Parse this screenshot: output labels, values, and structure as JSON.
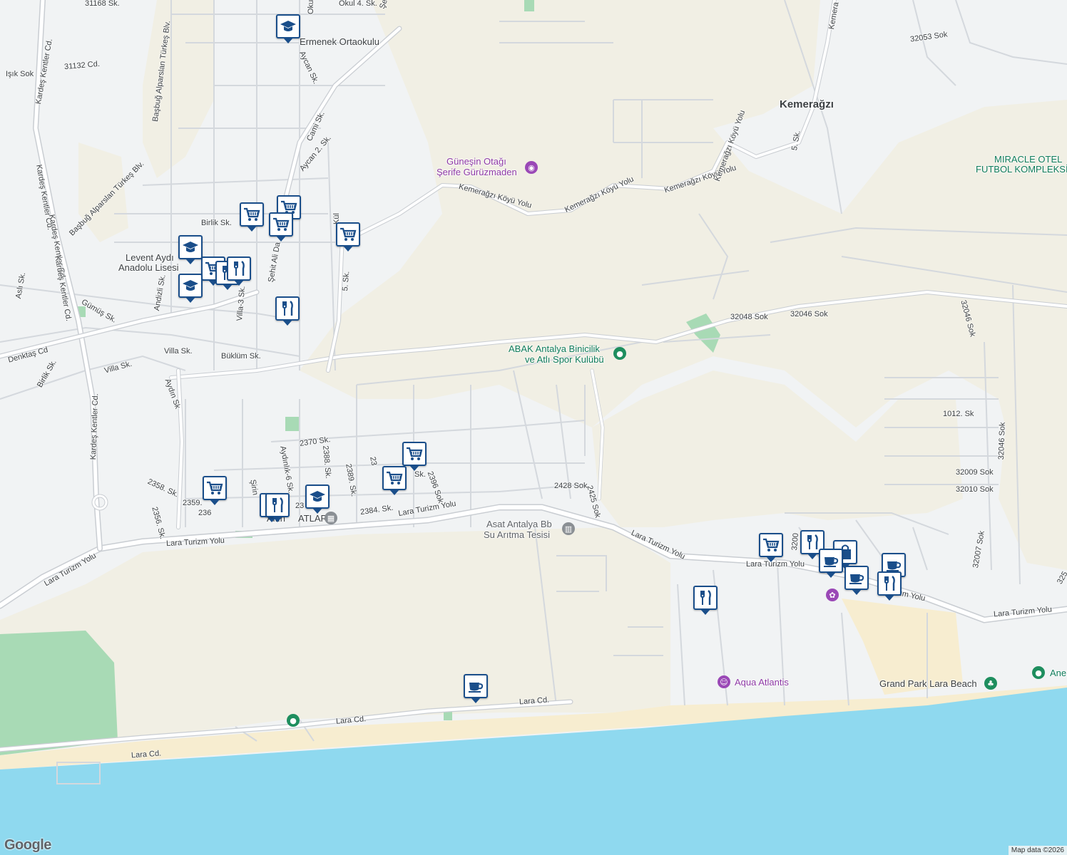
{
  "map": {
    "attribution": "Map data ©2026",
    "logo": "Google",
    "colors": {
      "land": "#f1f3f4",
      "beige": "#f1efe4",
      "sea": "#8fd9ef",
      "beach": "#f7edd0",
      "green": "#a8dab5",
      "road": "#ffffff",
      "road_edge": "#cfd4da"
    },
    "area_labels": {
      "kemeragzi": "Kemerağzı"
    },
    "poi_labels": {
      "gunesin_1": "Güneşin Otağı",
      "gunesin_2": "Şerife Gürüzmaden",
      "abak_1": "ABAK Antalya Binicilik",
      "abak_2": "ve Atlı Spor Kulübü",
      "asat_1": "Asat Antalya Bb",
      "asat_2": "Su Arıtma Tesisi",
      "aqua": "Aqua Atlantis",
      "grand_park": "Grand Park Lara Beach",
      "miracle_1": "MIRACLE OTEL",
      "miracle_2": "FUTBOL KOMPLEKSİ",
      "ane": "Ane",
      "ermenek": "Ermenek Ortaokulu",
      "levent_1": "Levent Aydı",
      "levent_2": "Anadolu Lisesi",
      "altin": "Altın",
      "atlar": "ATLAR"
    },
    "street_labels": {
      "s31168": "31168 Sk.",
      "okul4": "Okul 4. Sk.",
      "sehitali1": "Şehit Ali Da",
      "okul_v": "Okul",
      "s31132": "31132 Cd.",
      "isik": "Işık Sok",
      "kardes1": "Kardeş Kentler Cd.",
      "kardes2": "Kardeş Kentler Cd.",
      "kardes3": "Kardeş Kentler Cd.",
      "kardes4": "Kardeş Kentler Cd.",
      "kardes5": "Kardeş Kentler Cd.",
      "basbug1": "Başbuğ Alparslan Türkeş Blv.",
      "basbug2": "Başbuğ Alparslan Türkeş Blv.",
      "aycan": "Aycan Sk.",
      "cami": "Cami Sk.",
      "aycan2": "Aycan 2. Sk.",
      "birlik": "Birlik Sk.",
      "sehitali2": "Şehit Ali Da",
      "kul": "Kül",
      "sk5a": "5. Sk.",
      "asli": "Aslı Sk.",
      "andizli": "Andizli Sk.",
      "gumus": "Gümüş Sk.",
      "villa3": "Villa-3 Sk.",
      "denktas": "Denktaş Cd",
      "villa_sk": "Villa Sk.",
      "villa_sk2": "Villa Sk.",
      "buklum": "Büklüm Sk.",
      "birlik2": "Birlik Sk.",
      "aydin": "Aydın Sk",
      "s2370": "2370 Sk.",
      "s2388": "2388. Sk.",
      "s2389": "2389. Sk.",
      "aydinlik": "Aydınlık-6 Sk.",
      "s2396": "2396 Sok",
      "s23x": "23",
      "s2358": "2358. Sk.",
      "s2356": "2356. Sk.",
      "s2359": "2359.",
      "s236": "236",
      "sirin": "Şirin",
      "s2384": "2384. Sk.",
      "s23y": "23",
      "sk": "Sk.",
      "s2428": "2428 Sok",
      "s2425": "2425 Sok",
      "lara_tz1": "Lara Turizm Yolu",
      "lara_tz2": "Lara Turizm Yolu",
      "lara_tz3": "Lara Turizm Yolu",
      "lara_tz4": "Lara Turizm Yolu",
      "lara_tz5": "Lara Turizm Yolu",
      "lara_tz6": "Lara Turizm Yolu",
      "lara_tz7": "ızm Yolu",
      "lara_cd1": "Lara Cd.",
      "lara_cd2": "Lara Cd.",
      "lara_cd3": "Lara Cd.",
      "kemer_koy1": "Kemerağzı Köyü Yolu",
      "kemer_koy2": "Kemerağzı Köyü Yolu",
      "kemer_koy3": "Kemerağzı Köyü Yolu",
      "kemer_koy4": "Kemerağzı Köyü Yolu",
      "kemer_v": "Kemera",
      "sk5b": "5. Sk.",
      "s32053": "32053 Sok",
      "s32048": "32048 Sok",
      "s32046": "32046 Sok",
      "s32046v": "32046 Sok",
      "s32046v2": "32046 Sok",
      "s1012": "1012. Sk",
      "s32009": "32009 Sok",
      "s32010": "32010 Sok",
      "s32007": "32007 Sok",
      "s325": "325",
      "s3200": "3200"
    },
    "markers": [
      {
        "type": "school",
        "icon": "school-icon"
      },
      {
        "type": "shopping",
        "icon": "shopping-cart-icon"
      },
      {
        "type": "shopping",
        "icon": "shopping-cart-icon"
      },
      {
        "type": "shopping",
        "icon": "shopping-cart-icon"
      },
      {
        "type": "shopping",
        "icon": "shopping-cart-icon"
      },
      {
        "type": "school",
        "icon": "school-icon"
      },
      {
        "type": "shopping",
        "icon": "shopping-cart-icon"
      },
      {
        "type": "restaurant",
        "icon": "restaurant-icon"
      },
      {
        "type": "restaurant",
        "icon": "restaurant-icon"
      },
      {
        "type": "school",
        "icon": "school-icon"
      },
      {
        "type": "restaurant",
        "icon": "restaurant-icon"
      },
      {
        "type": "shopping",
        "icon": "shopping-cart-icon"
      },
      {
        "type": "shopping",
        "icon": "shopping-cart-icon"
      },
      {
        "type": "shopping",
        "icon": "shopping-cart-icon"
      },
      {
        "type": "restaurant",
        "icon": "restaurant-icon"
      },
      {
        "type": "school",
        "icon": "school-icon"
      },
      {
        "type": "restaurant",
        "icon": "restaurant-icon"
      },
      {
        "type": "cafe",
        "icon": "coffee-cup-icon"
      },
      {
        "type": "shopping",
        "icon": "shopping-cart-icon"
      },
      {
        "type": "restaurant",
        "icon": "restaurant-icon"
      },
      {
        "type": "restaurant",
        "icon": "restaurant-icon"
      },
      {
        "type": "shopping",
        "icon": "shopping-bag-icon"
      },
      {
        "type": "cafe",
        "icon": "coffee-cup-icon"
      },
      {
        "type": "cafe",
        "icon": "coffee-cup-icon"
      },
      {
        "type": "cafe",
        "icon": "coffee-cup-icon"
      },
      {
        "type": "restaurant",
        "icon": "restaurant-icon"
      }
    ]
  }
}
